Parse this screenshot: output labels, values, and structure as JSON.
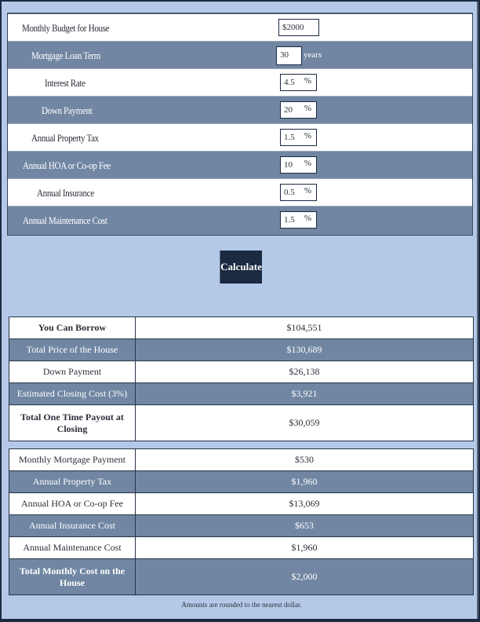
{
  "inputs": [
    {
      "label": "Monthly Budget for House",
      "value": "$2000",
      "suffix": ""
    },
    {
      "label": "Mortgage Loan Term",
      "value": "30",
      "suffix": "years"
    },
    {
      "label": "Interest Rate",
      "value": "4.5",
      "suffix": "%"
    },
    {
      "label": "Down Payment",
      "value": "20",
      "suffix": "%"
    },
    {
      "label": "Annual Property Tax",
      "value": "1.5",
      "suffix": "%"
    },
    {
      "label": "Annual HOA or Co-op Fee",
      "value": "10",
      "suffix": "%"
    },
    {
      "label": "Annual Insurance",
      "value": "0.5",
      "suffix": "%"
    },
    {
      "label": "Annual Maintenance Cost",
      "value": "1.5",
      "suffix": "%"
    }
  ],
  "calculate_label": "Calculate",
  "results_one_time": [
    {
      "label": "You Can Borrow",
      "value": "$104,551"
    },
    {
      "label": "Total Price of the House",
      "value": "$130,689"
    },
    {
      "label": "Down Payment",
      "value": "$26,138"
    },
    {
      "label": "Estimated Closing Cost (3%)",
      "value": "$3,921"
    },
    {
      "label": "Total One Time Payout at Closing",
      "value": "$30,059"
    }
  ],
  "results_recurring": [
    {
      "label": "Monthly Mortgage Payment",
      "value": "$530"
    },
    {
      "label": "Annual Property Tax",
      "value": "$1,960"
    },
    {
      "label": "Annual HOA or Co-op Fee",
      "value": "$13,069"
    },
    {
      "label": "Annual Insurance Cost",
      "value": "$653"
    },
    {
      "label": "Annual Maintenance Cost",
      "value": "$1,960"
    },
    {
      "label": "Total Monthly Cost on the House",
      "value": "$2,000"
    }
  ],
  "footnote": "Amounts are rounded to the nearest dollar.",
  "colors": {
    "accent_dark": "#1b2a41",
    "row_slate": "#7086a2",
    "background": "#b4c9e8"
  }
}
